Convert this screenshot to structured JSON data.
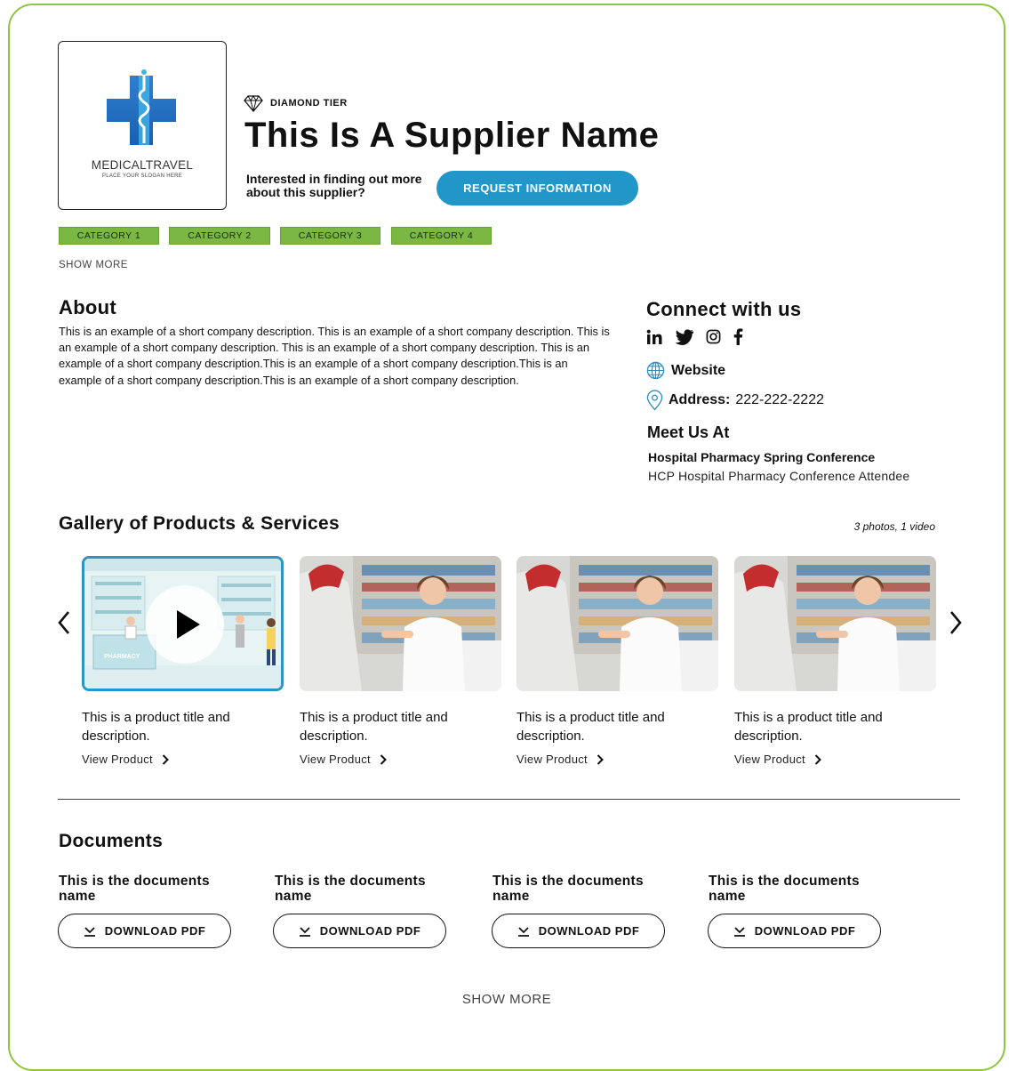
{
  "logo": {
    "wordmark": "MEDICALTRAVEL",
    "slogan": "PLACE YOUR SLOGAN HERE"
  },
  "header": {
    "tier_label": "DIAMOND TIER",
    "supplier_name": "This Is A Supplier Name",
    "interest_text": "Interested in finding out more about this supplier?",
    "request_button": "REQUEST INFORMATION"
  },
  "categories": [
    "CATEGORY 1",
    "CATEGORY 2",
    "CATEGORY 3",
    "CATEGORY 4"
  ],
  "categories_show_more": "SHOW MORE",
  "about": {
    "title": "About",
    "text": "This is an example of a short company description. This is an example of a short company description. This is an example of a short company description. This is an example of a short company description. This is an example of a short company description.This is an example of a short company description.This is an example of a short company description.This is an example of a short company description."
  },
  "connect": {
    "title": "Connect with us",
    "social_icons": [
      "linkedin-icon",
      "twitter-icon",
      "instagram-icon",
      "facebook-icon"
    ],
    "website_label": "Website",
    "address_label": "Address:",
    "address_value": "222-222-2222"
  },
  "meet": {
    "title": "Meet Us At",
    "conference": "Hospital Pharmacy Spring Conference",
    "role": "HCP Hospital Pharmacy Conference Attendee"
  },
  "gallery": {
    "title": "Gallery of Products & Services",
    "count": "3 photos, 1 video",
    "items": [
      {
        "type": "video",
        "title": "This is a product title and description.",
        "link": "View Product",
        "scene_label": "PHARMACY"
      },
      {
        "type": "photo",
        "title": "This is a product title and description.",
        "link": "View Product"
      },
      {
        "type": "photo",
        "title": "This is a product title and description.",
        "link": "View Product"
      },
      {
        "type": "photo",
        "title": "This is a product title and description.",
        "link": "View Product"
      }
    ]
  },
  "documents": {
    "title": "Documents",
    "items": [
      {
        "name": "This is the documents name",
        "button": "DOWNLOAD PDF"
      },
      {
        "name": "This is the documents name",
        "button": "DOWNLOAD PDF"
      },
      {
        "name": "This is the documents name",
        "button": "DOWNLOAD PDF"
      },
      {
        "name": "This is the documents name",
        "button": "DOWNLOAD PDF"
      }
    ],
    "show_more": "SHOW MORE"
  },
  "colors": {
    "frame": "#8dc63f",
    "category_bg": "#7ab843",
    "accent_blue": "#2196c9"
  }
}
